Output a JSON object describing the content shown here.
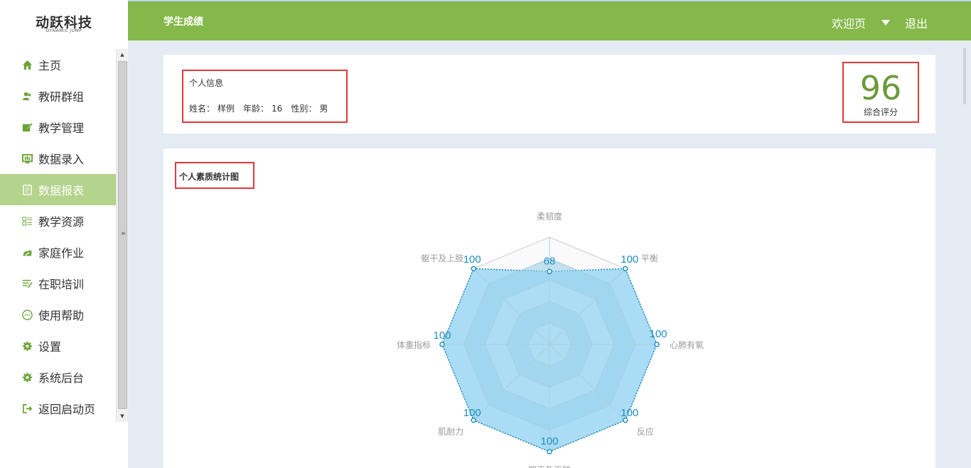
{
  "brand": {
    "name": "动跃科技",
    "subtitle": "DYNAMIC JUMP"
  },
  "sidebar": {
    "items": [
      {
        "label": "主页",
        "icon": "home-icon"
      },
      {
        "label": "教研群组",
        "icon": "users-icon"
      },
      {
        "label": "教学管理",
        "icon": "edit-icon"
      },
      {
        "label": "数据录入",
        "icon": "monitor-icon"
      },
      {
        "label": "数据报表",
        "icon": "report-icon",
        "active": true
      },
      {
        "label": "教学资源",
        "icon": "list-icon"
      },
      {
        "label": "家庭作业",
        "icon": "cloud-icon"
      },
      {
        "label": "在职培训",
        "icon": "lines-icon"
      },
      {
        "label": "使用帮助",
        "icon": "dots-icon"
      },
      {
        "label": "设置",
        "icon": "gear-icon"
      },
      {
        "label": "系统后台",
        "icon": "gear-icon"
      },
      {
        "label": "返回启动页",
        "icon": "exit-icon"
      }
    ]
  },
  "header": {
    "title": "学生成绩",
    "welcome": "欢迎页",
    "logout": "退出"
  },
  "info": {
    "title": "个人信息",
    "name_label": "姓名：",
    "name": "样例",
    "age_label": "年龄：",
    "age": "16",
    "gender_label": "性别：",
    "gender": "男"
  },
  "score": {
    "value": "96",
    "label": "综合评分"
  },
  "chart_section": {
    "title": "个人素质统计图"
  },
  "colors": {
    "accent": "#84b84a",
    "active_menu": "#b4d38c",
    "radar_fill": "#87cff3",
    "radar_line": "#1e8fbf",
    "highlight": "#e03a3a"
  },
  "chart_data": {
    "type": "radar",
    "indicators": [
      "柔韧度",
      "平衡",
      "心肺有氧",
      "反应",
      "躯干及下肢",
      "肌耐力",
      "体重指标",
      "躯干及上肢"
    ],
    "values": [
      68,
      100,
      100,
      100,
      100,
      100,
      100,
      100
    ],
    "max": 100,
    "value_labels": [
      "68",
      "100",
      "100",
      "100",
      "100",
      "100",
      "100",
      "100"
    ]
  }
}
